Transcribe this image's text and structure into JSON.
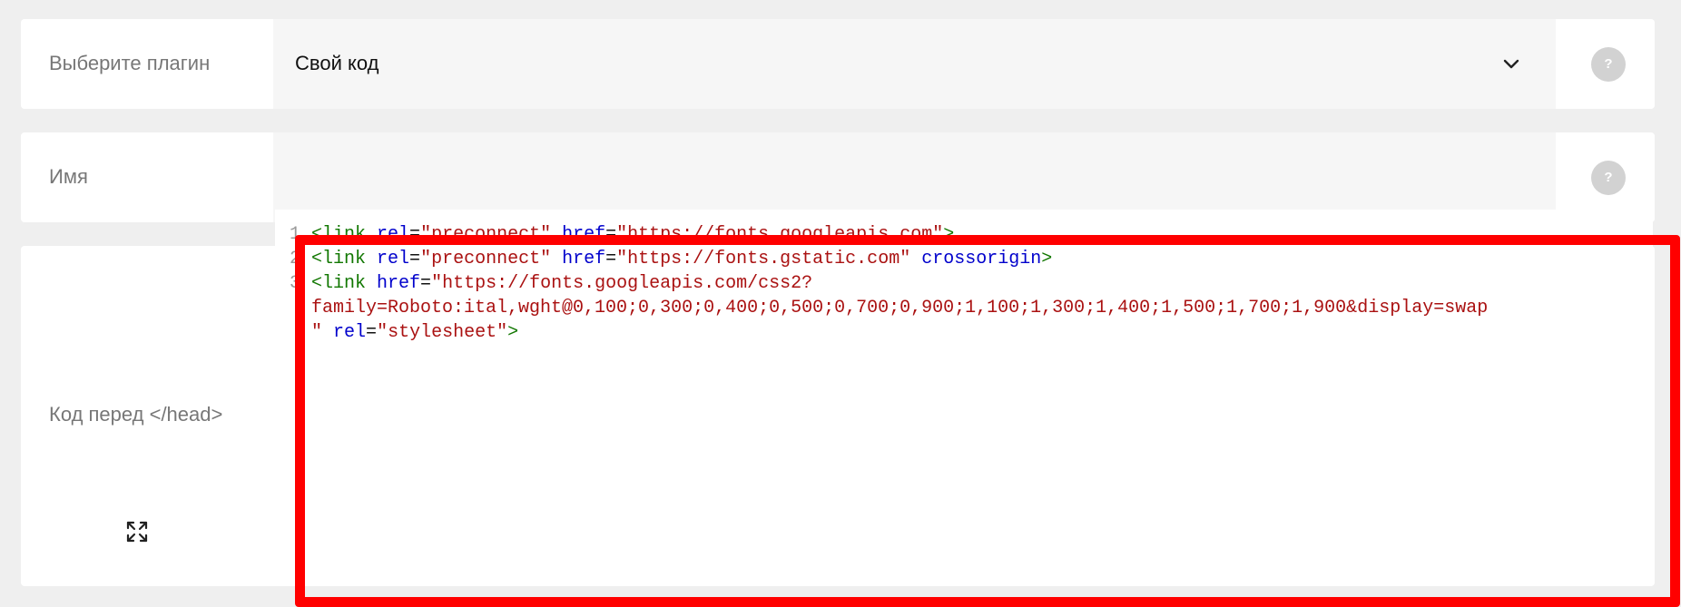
{
  "plugin_row": {
    "label": "Выберите плагин",
    "selected_value": "Свой код",
    "help": "?"
  },
  "name_row": {
    "label": "Имя",
    "value": "",
    "help": "?"
  },
  "code_row": {
    "label": "Код перед </head>",
    "help": "?",
    "gutter": [
      "1",
      "2",
      "3"
    ],
    "lines": [
      [
        {
          "t": "tag",
          "v": "<link"
        },
        {
          "t": "plain",
          "v": " "
        },
        {
          "t": "attr",
          "v": "rel"
        },
        {
          "t": "plain",
          "v": "="
        },
        {
          "t": "str",
          "v": "\"preconnect\""
        },
        {
          "t": "plain",
          "v": " "
        },
        {
          "t": "attr",
          "v": "href"
        },
        {
          "t": "plain",
          "v": "="
        },
        {
          "t": "str",
          "v": "\"https://fonts.googleapis.com\""
        },
        {
          "t": "tag",
          "v": ">"
        }
      ],
      [
        {
          "t": "tag",
          "v": "<link"
        },
        {
          "t": "plain",
          "v": " "
        },
        {
          "t": "attr",
          "v": "rel"
        },
        {
          "t": "plain",
          "v": "="
        },
        {
          "t": "str",
          "v": "\"preconnect\""
        },
        {
          "t": "plain",
          "v": " "
        },
        {
          "t": "attr",
          "v": "href"
        },
        {
          "t": "plain",
          "v": "="
        },
        {
          "t": "str",
          "v": "\"https://fonts.gstatic.com\""
        },
        {
          "t": "plain",
          "v": " "
        },
        {
          "t": "attr",
          "v": "crossorigin"
        },
        {
          "t": "tag",
          "v": ">"
        }
      ],
      [
        {
          "t": "tag",
          "v": "<link"
        },
        {
          "t": "plain",
          "v": " "
        },
        {
          "t": "attr",
          "v": "href"
        },
        {
          "t": "plain",
          "v": "="
        },
        {
          "t": "str",
          "v": "\"https://fonts.googleapis.com/css2?"
        }
      ],
      [
        {
          "t": "str",
          "v": "family=Roboto:ital,wght@0,100;0,300;0,400;0,500;0,700;0,900;1,100;1,300;1,400;1,500;1,700;1,900&display=swap"
        }
      ],
      [
        {
          "t": "str",
          "v": "\""
        },
        {
          "t": "plain",
          "v": " "
        },
        {
          "t": "attr",
          "v": "rel"
        },
        {
          "t": "plain",
          "v": "="
        },
        {
          "t": "str",
          "v": "\"stylesheet\""
        },
        {
          "t": "tag",
          "v": ">"
        }
      ]
    ]
  },
  "icons": {
    "chevron": "chevron-down-icon",
    "expand": "expand-icon",
    "help": "help-icon"
  },
  "colors": {
    "page_bg": "#efefef",
    "field_bg": "#f6f6f6",
    "highlight": "#ff0000",
    "tag": "#117700",
    "attr": "#0000cc",
    "string": "#aa1111"
  }
}
